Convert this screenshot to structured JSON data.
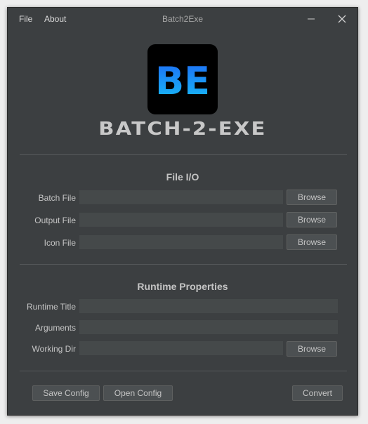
{
  "window": {
    "title": "Batch2Exe",
    "menu": [
      "File",
      "About"
    ]
  },
  "logo": {
    "letters": "BE",
    "brand": "BATCH-2-EXE"
  },
  "file_io": {
    "title": "File I/O",
    "rows": [
      {
        "label": "Batch File",
        "value": "",
        "button": "Browse"
      },
      {
        "label": "Output File",
        "value": "",
        "button": "Browse"
      },
      {
        "label": "Icon File",
        "value": "",
        "button": "Browse"
      }
    ]
  },
  "runtime": {
    "title": "Runtime Properties",
    "rows": [
      {
        "label": "Runtime Title",
        "value": ""
      },
      {
        "label": "Arguments",
        "value": ""
      },
      {
        "label": "Working Dir",
        "value": "",
        "button": "Browse"
      }
    ]
  },
  "footer": {
    "save_config": "Save Config",
    "open_config": "Open Config",
    "convert": "Convert"
  },
  "colors": {
    "background": "#3c3f41",
    "field": "#45494a",
    "button": "#4c5052",
    "logo_gradient_top": "#1e6bf5",
    "logo_gradient_bottom": "#17bdf7"
  }
}
